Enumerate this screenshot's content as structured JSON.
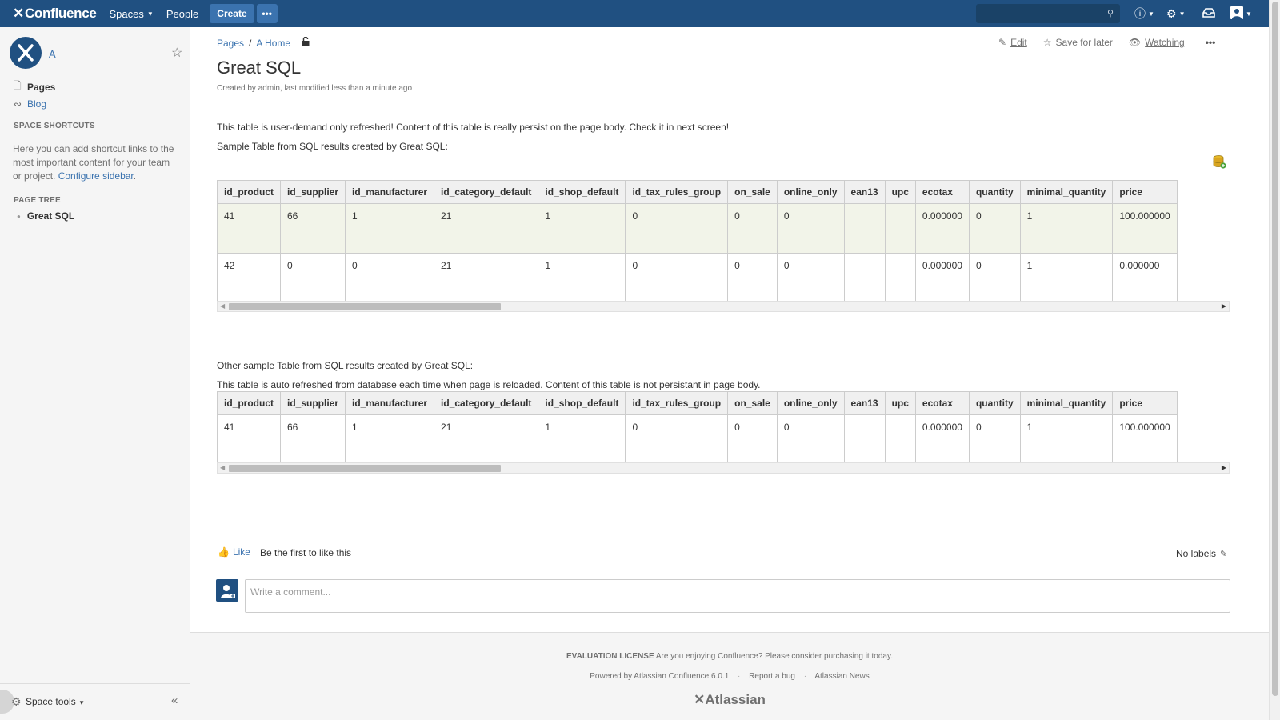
{
  "topbar": {
    "logo_text": "Confluence",
    "nav": {
      "spaces": "Spaces",
      "people": "People"
    },
    "create_label": "Create",
    "more_label": "•••"
  },
  "sidebar": {
    "space_name": "A",
    "nav": {
      "pages": "Pages",
      "blog": "Blog"
    },
    "shortcuts_heading": "SPACE SHORTCUTS",
    "shortcuts_text": "Here you can add shortcut links to the most important content for your team or project.",
    "configure_link": "Configure sidebar",
    "page_tree_heading": "PAGE TREE",
    "tree_item": "Great SQL",
    "space_tools": "Space tools"
  },
  "breadcrumb": {
    "pages": "Pages",
    "home": "A Home"
  },
  "page_actions": {
    "edit": "Edit",
    "save": "Save for later",
    "watching": "Watching"
  },
  "page": {
    "title": "Great SQL",
    "meta": "Created by admin, last modified less than a minute ago",
    "para1": "This table is user-demand only refreshed! Content of this table is really persist on the page body. Check it in next screen!",
    "para2": "Sample Table from SQL results created by Great SQL:",
    "para3": "Other sample Table from SQL results created by Great SQL:",
    "para4": "This table is auto refreshed from database each time when page is reloaded. Content of this table is not persistant in page body."
  },
  "table1": {
    "columns": [
      "id_product",
      "id_supplier",
      "id_manufacturer",
      "id_category_default",
      "id_shop_default",
      "id_tax_rules_group",
      "on_sale",
      "online_only",
      "ean13",
      "upc",
      "ecotax",
      "quantity",
      "minimal_quantity",
      "price"
    ],
    "rows": [
      [
        "41",
        "66",
        "1",
        "21",
        "1",
        "0",
        "0",
        "0",
        "",
        "",
        "0.000000",
        "0",
        "1",
        "100.000000"
      ],
      [
        "42",
        "0",
        "0",
        "21",
        "1",
        "0",
        "0",
        "0",
        "",
        "",
        "0.000000",
        "0",
        "1",
        "0.000000"
      ]
    ]
  },
  "table2": {
    "columns": [
      "id_product",
      "id_supplier",
      "id_manufacturer",
      "id_category_default",
      "id_shop_default",
      "id_tax_rules_group",
      "on_sale",
      "online_only",
      "ean13",
      "upc",
      "ecotax",
      "quantity",
      "minimal_quantity",
      "price"
    ],
    "rows": [
      [
        "41",
        "66",
        "1",
        "21",
        "1",
        "0",
        "0",
        "0",
        "",
        "",
        "0.000000",
        "0",
        "1",
        "100.000000"
      ]
    ]
  },
  "social": {
    "like": "Like",
    "like_text": "Be the first to like this",
    "no_labels": "No labels",
    "comment_placeholder": "Write a comment..."
  },
  "footer": {
    "license_bold": "EVALUATION LICENSE",
    "license_text": "Are you enjoying Confluence? Please consider purchasing it today.",
    "powered": "Powered by Atlassian Confluence 6.0.1",
    "report_bug": "Report a bug",
    "news": "Atlassian News",
    "logo": "Atlassian"
  },
  "colors": {
    "header": "#205081",
    "link": "#3b73af",
    "row_highlight": "#f2f4e9"
  }
}
